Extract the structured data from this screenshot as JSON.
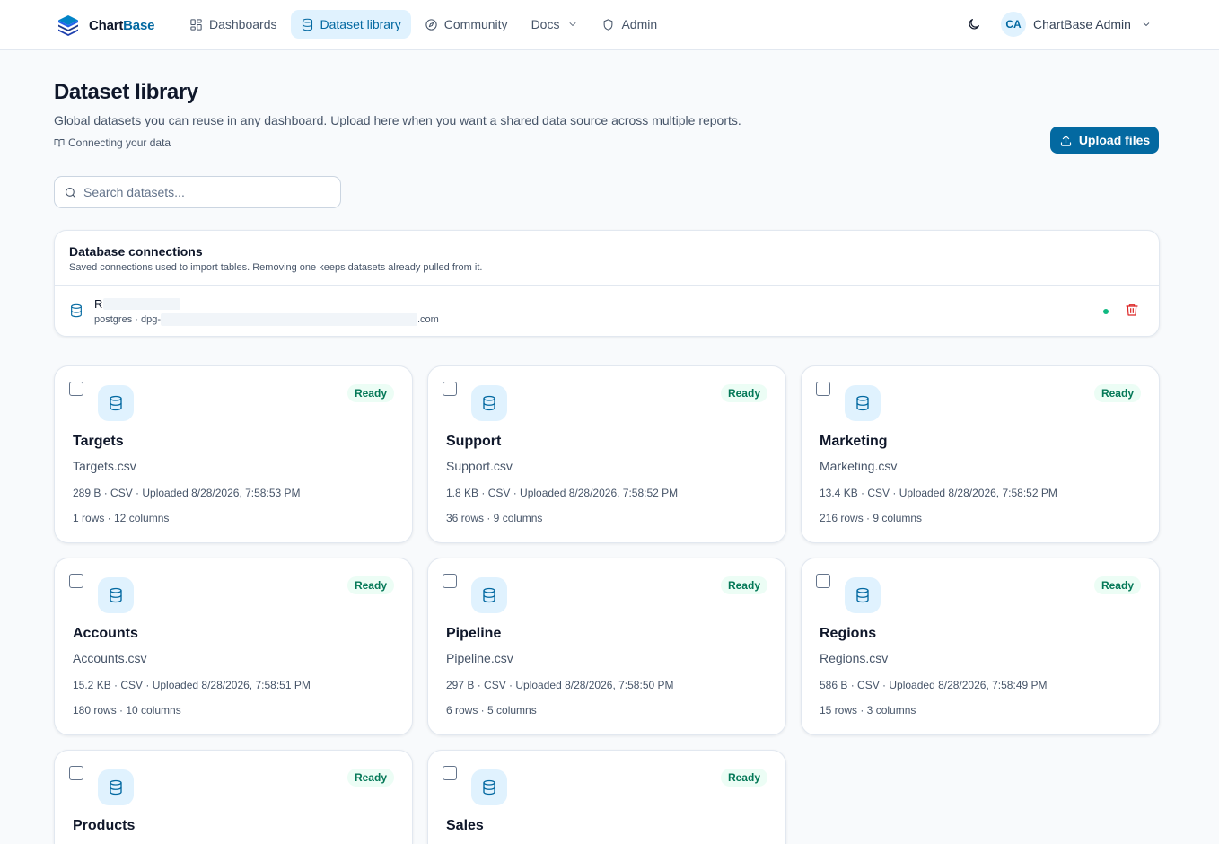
{
  "app": {
    "brand_prefix": "Chart",
    "brand_suffix": "Base",
    "colors": {
      "accent": "#0369a1",
      "accent_soft": "#e0f2fe",
      "ready": "#047857",
      "ready_bg": "#ecfdf5",
      "danger": "#dc2626",
      "online": "#10b981"
    }
  },
  "nav": {
    "items": [
      {
        "label": "Dashboards",
        "icon": "grid-icon"
      },
      {
        "label": "Dataset library",
        "icon": "database-icon",
        "active": true
      },
      {
        "label": "Community",
        "icon": "compass-icon"
      },
      {
        "label": "Docs",
        "icon": "chevron-down-icon"
      },
      {
        "label": "Admin",
        "icon": "shield-icon"
      }
    ]
  },
  "user": {
    "initials": "CA",
    "name": "ChartBase Admin"
  },
  "page": {
    "title": "Dataset library",
    "description": "Global datasets you can reuse in any dashboard. Upload here when you want a shared data source across multiple reports.",
    "doc_link": "Connecting your data",
    "upload_label": "Upload files"
  },
  "search": {
    "placeholder": "Search datasets...",
    "value": ""
  },
  "connections": {
    "title": "Database connections",
    "subtitle": "Saved connections used to import tables. Removing one keeps datasets already pulled from it.",
    "items": [
      {
        "name_visible": "R",
        "meta_prefix": "postgres · dpg-",
        "meta_suffix": ".com",
        "status": "connected"
      }
    ]
  },
  "datasets": [
    {
      "name": "Targets",
      "file": "Targets.csv",
      "info": "289 B · CSV · Uploaded 8/28/2026, 7:58:53 PM",
      "dims": "1 rows · 12 columns",
      "status": "Ready"
    },
    {
      "name": "Support",
      "file": "Support.csv",
      "info": "1.8 KB · CSV · Uploaded 8/28/2026, 7:58:52 PM",
      "dims": "36 rows · 9 columns",
      "status": "Ready"
    },
    {
      "name": "Marketing",
      "file": "Marketing.csv",
      "info": "13.4 KB · CSV · Uploaded 8/28/2026, 7:58:52 PM",
      "dims": "216 rows · 9 columns",
      "status": "Ready"
    },
    {
      "name": "Accounts",
      "file": "Accounts.csv",
      "info": "15.2 KB · CSV · Uploaded 8/28/2026, 7:58:51 PM",
      "dims": "180 rows · 10 columns",
      "status": "Ready"
    },
    {
      "name": "Pipeline",
      "file": "Pipeline.csv",
      "info": "297 B · CSV · Uploaded 8/28/2026, 7:58:50 PM",
      "dims": "6 rows · 5 columns",
      "status": "Ready"
    },
    {
      "name": "Regions",
      "file": "Regions.csv",
      "info": "586 B · CSV · Uploaded 8/28/2026, 7:58:49 PM",
      "dims": "15 rows · 3 columns",
      "status": "Ready"
    },
    {
      "name": "Products",
      "file": "",
      "info": "",
      "dims": "",
      "status": "Ready"
    },
    {
      "name": "Sales",
      "file": "",
      "info": "",
      "dims": "",
      "status": "Ready"
    }
  ]
}
